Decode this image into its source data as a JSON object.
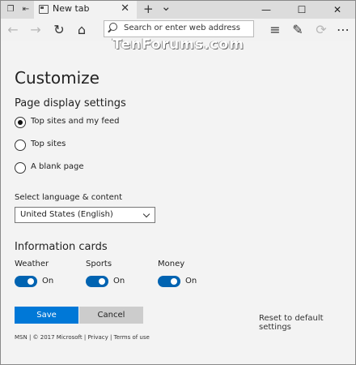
{
  "browser": {
    "tab_title": "New tab",
    "address_placeholder": "Search or enter web address",
    "watermark": "TenForums.com",
    "new_tab_symbol": "+",
    "tab_list_symbol": "⌄",
    "close_symbol": "✕",
    "minimize_symbol": "—",
    "maximize_symbol": "☐"
  },
  "page": {
    "title": "Customize",
    "display_settings_title": "Page display settings",
    "display_options": [
      {
        "label": "Top sites and my feed",
        "selected": true
      },
      {
        "label": "Top sites",
        "selected": false
      },
      {
        "label": "A blank page",
        "selected": false
      }
    ],
    "language_label": "Select language & content",
    "language_value": "United States (English)",
    "info_cards_title": "Information cards",
    "cards": [
      {
        "label": "Weather",
        "state": "On"
      },
      {
        "label": "Sports",
        "state": "On"
      },
      {
        "label": "Money",
        "state": "On"
      }
    ],
    "save_label": "Save",
    "cancel_label": "Cancel",
    "reset_label": "Reset to default settings",
    "footer": "MSN | © 2017 Microsoft | Privacy | Terms of use"
  },
  "colors": {
    "accent": "#0078d7",
    "toggle_on": "#0063b1"
  }
}
